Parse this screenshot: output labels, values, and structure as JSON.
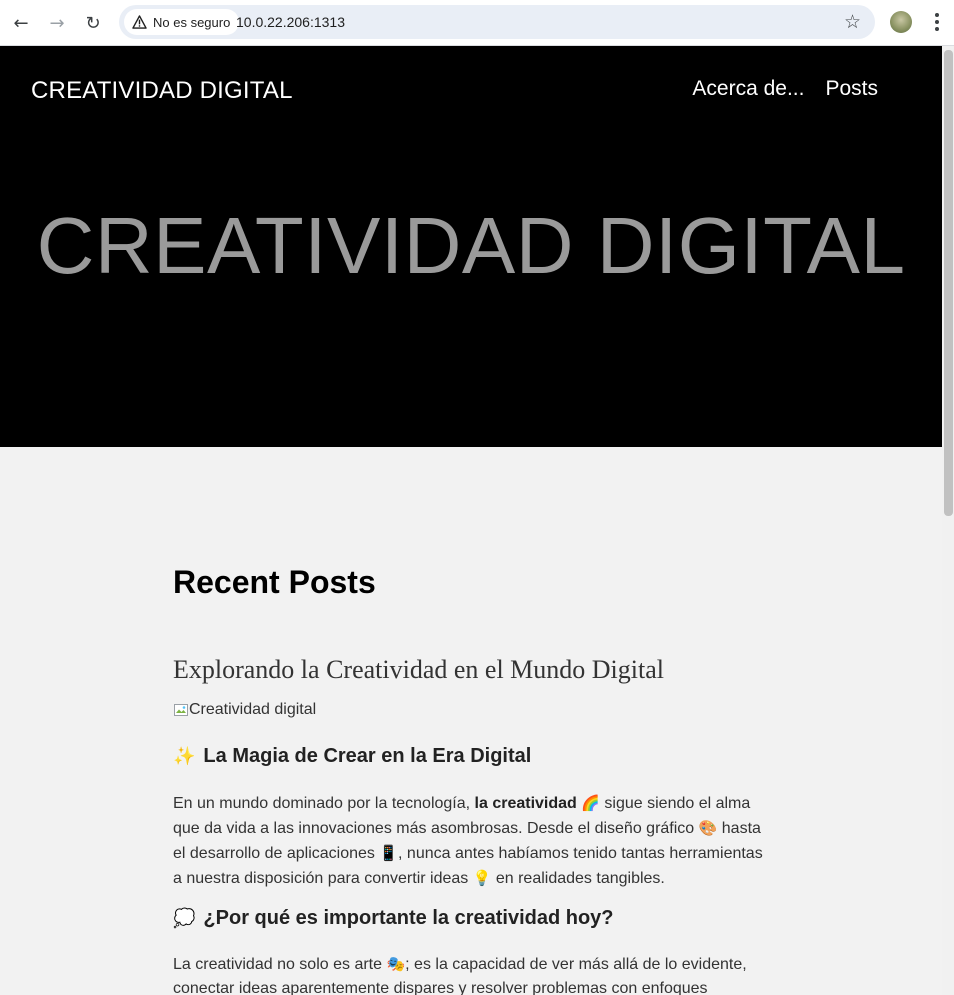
{
  "browser": {
    "security_label": "No es seguro",
    "url": "10.0.22.206:1313"
  },
  "site": {
    "brand": "CREATIVIDAD DIGITAL",
    "nav": [
      "Acerca de...",
      "Posts"
    ],
    "hero_title": "CREATIVIDAD DIGITAL"
  },
  "content": {
    "section_title": "Recent Posts",
    "post": {
      "title": "Explorando la Creatividad en el Mundo Digital",
      "image_alt": "Creatividad digital",
      "h1_emoji": "✨",
      "h1": "La Magia de Crear en la Era Digital",
      "p1_a": "En un mundo dominado por la tecnología, ",
      "p1_bold": "la creatividad",
      "p1_e1": "🌈",
      "p1_b": " sigue siendo el alma que da vida a las innovaciones más asombrosas. Desde el diseño gráfico ",
      "p1_e2": "🎨",
      "p1_c": " hasta el desarrollo de aplicaciones ",
      "p1_e3": "📱",
      "p1_d": ", nunca antes habíamos tenido tantas herramientas a nuestra disposición para convertir ideas ",
      "p1_e4": "💡",
      "p1_e": " en realidades tangibles.",
      "h2_emoji": "💭",
      "h2": "¿Por qué es importante la creatividad hoy?",
      "p2_a": "La creatividad no solo es arte ",
      "p2_e1": "🎭",
      "p2_b": "; es la capacidad de ver más allá de lo evidente, conectar ideas aparentemente dispares y resolver problemas con enfoques"
    }
  }
}
